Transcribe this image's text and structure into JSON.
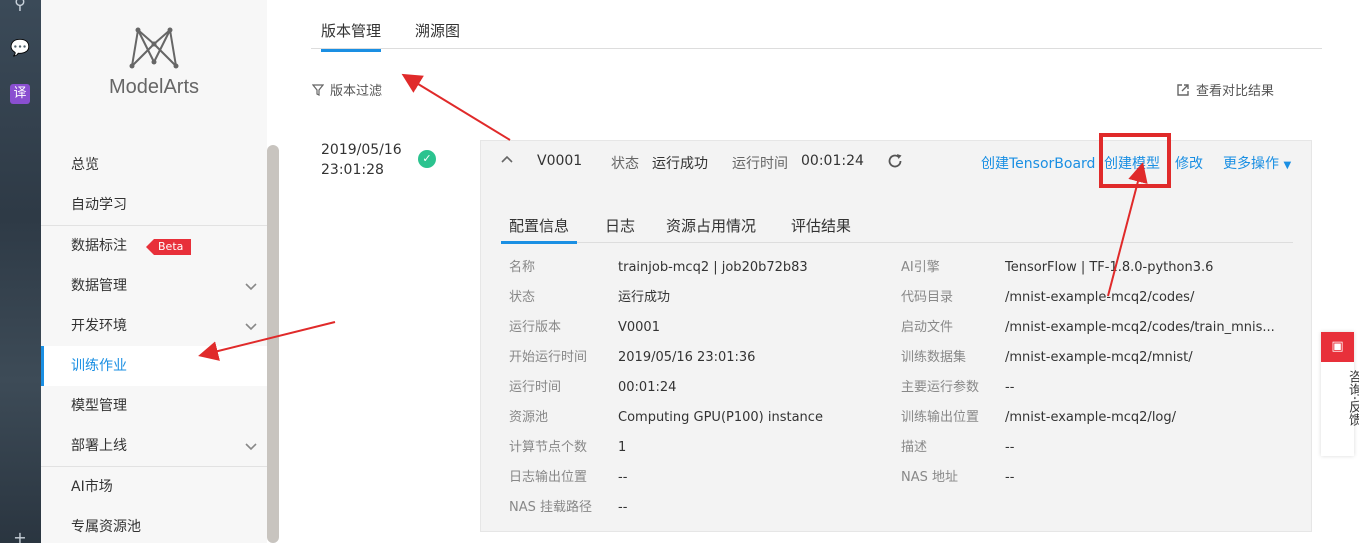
{
  "rail": {
    "icons": [
      "search-icon",
      "chat-icon",
      "translate-icon",
      "plus-icon"
    ],
    "translate_label": "译"
  },
  "sidebar": {
    "brand": "ModelArts",
    "items": [
      {
        "label": "总览"
      },
      {
        "label": "自动学习"
      },
      {
        "label": "数据标注",
        "badge": "Beta"
      },
      {
        "label": "数据管理",
        "expandable": true
      },
      {
        "label": "开发环境",
        "expandable": true
      },
      {
        "label": "训练作业",
        "active": true
      },
      {
        "label": "模型管理"
      },
      {
        "label": "部署上线",
        "expandable": true
      },
      {
        "label": "AI市场"
      },
      {
        "label": "专属资源池"
      }
    ]
  },
  "tabs": [
    {
      "label": "版本管理",
      "active": true
    },
    {
      "label": "溯源图"
    }
  ],
  "toolbar": {
    "filter": "版本过滤",
    "compare": "查看对比结果"
  },
  "run": {
    "date": "2019/05/16",
    "time": "23:01:28",
    "version": "V0001",
    "status_label": "状态",
    "status_value": "运行成功",
    "runtime_label": "运行时间",
    "runtime_value": "00:01:24",
    "actions": {
      "tensorboard": "创建TensorBoard",
      "create_model": "创建模型",
      "edit": "修改",
      "more": "更多操作"
    }
  },
  "detail_tabs": [
    {
      "label": "配置信息",
      "active": true
    },
    {
      "label": "日志"
    },
    {
      "label": "资源占用情况"
    },
    {
      "label": "评估结果"
    }
  ],
  "config_left": [
    {
      "k": "名称",
      "v": "trainjob-mcq2 | job20b72b83"
    },
    {
      "k": "状态",
      "v": "运行成功"
    },
    {
      "k": "运行版本",
      "v": "V0001"
    },
    {
      "k": "开始运行时间",
      "v": "2019/05/16 23:01:36"
    },
    {
      "k": "运行时间",
      "v": "00:01:24"
    },
    {
      "k": "资源池",
      "v": "Computing GPU(P100) instance"
    },
    {
      "k": "计算节点个数",
      "v": "1"
    },
    {
      "k": "日志输出位置",
      "v": "--"
    },
    {
      "k": "NAS 挂载路径",
      "v": "--"
    }
  ],
  "config_right": [
    {
      "k": "AI引擎",
      "v": "TensorFlow | TF-1.8.0-python3.6"
    },
    {
      "k": "代码目录",
      "v": "/mnist-example-mcq2/codes/"
    },
    {
      "k": "启动文件",
      "v": "/mnist-example-mcq2/codes/train_mnis..."
    },
    {
      "k": "训练数据集",
      "v": "/mnist-example-mcq2/mnist/"
    },
    {
      "k": "主要运行参数",
      "v": "--"
    },
    {
      "k": "训练输出位置",
      "v": "/mnist-example-mcq2/log/"
    },
    {
      "k": "描述",
      "v": "--"
    },
    {
      "k": "NAS 地址",
      "v": "--"
    }
  ],
  "feedback": {
    "label": "咨询·反馈"
  },
  "colors": {
    "accent": "#1a8fe3",
    "success": "#2bc38f",
    "highlight": "#e02a2a",
    "badge": "#e8303a"
  }
}
